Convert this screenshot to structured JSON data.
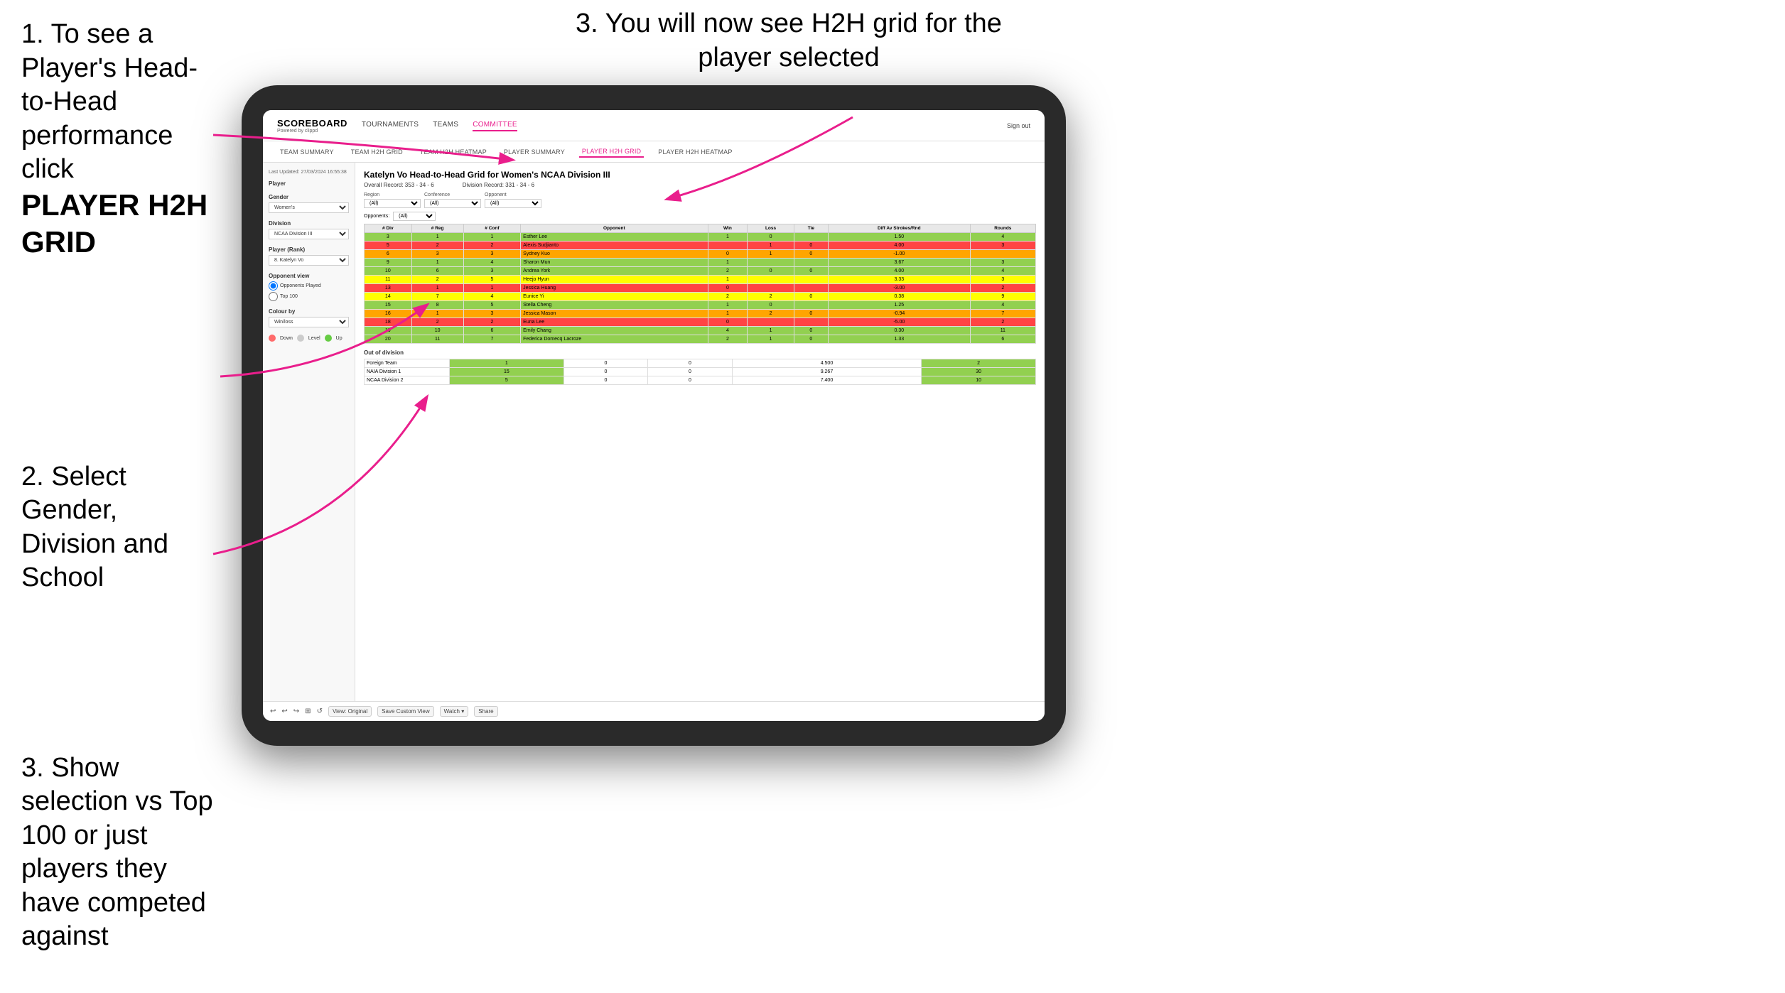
{
  "instructions": {
    "step1": {
      "text": "1. To see a Player's Head-to-Head performance click",
      "bold": "PLAYER H2H GRID"
    },
    "step2": {
      "text": "2. Select Gender, Division and School"
    },
    "step3_left": {
      "text": "3. Show selection vs Top 100 or just players they have competed against"
    },
    "step3_right": {
      "text": "3. You will now see H2H grid for the player selected"
    }
  },
  "nav": {
    "logo": "SCOREBOARD",
    "logo_sub": "Powered by clippd",
    "items": [
      "TOURNAMENTS",
      "TEAMS",
      "COMMITTEE"
    ],
    "sign_out": "Sign out",
    "sub_items": [
      "TEAM SUMMARY",
      "TEAM H2H GRID",
      "TEAM H2H HEATMAP",
      "PLAYER SUMMARY",
      "PLAYER H2H GRID",
      "PLAYER H2H HEATMAP"
    ]
  },
  "sidebar": {
    "updated": "Last Updated: 27/03/2024 16:55:38",
    "player_label": "Player",
    "gender_label": "Gender",
    "gender_value": "Women's",
    "division_label": "Division",
    "division_value": "NCAA Division III",
    "player_rank_label": "Player (Rank)",
    "player_rank_value": "8. Katelyn Vo",
    "opponent_view_label": "Opponent view",
    "radio1": "Opponents Played",
    "radio2": "Top 100",
    "colour_label": "Colour by",
    "colour_value": "Win/loss",
    "legend": [
      "Down",
      "Level",
      "Up"
    ]
  },
  "grid": {
    "title": "Katelyn Vo Head-to-Head Grid for Women's NCAA Division III",
    "overall_record": "Overall Record: 353 - 34 - 6",
    "division_record": "Division Record: 331 - 34 - 6",
    "region_label": "Region",
    "conference_label": "Conference",
    "opponent_label": "Opponent",
    "opponents_label": "Opponents:",
    "filter_all": "(All)",
    "columns": [
      "# Div",
      "# Reg",
      "# Conf",
      "Opponent",
      "Win",
      "Loss",
      "Tie",
      "Diff Av Strokes/Rnd",
      "Rounds"
    ],
    "rows": [
      {
        "div": "3",
        "reg": "1",
        "conf": "1",
        "opponent": "Esther Lee",
        "win": "1",
        "loss": "0",
        "tie": "",
        "diff": "1.50",
        "rounds": "4",
        "win_color": "green",
        "loss_color": "",
        "tie_color": ""
      },
      {
        "div": "5",
        "reg": "2",
        "conf": "2",
        "opponent": "Alexis Sudjianto",
        "win": "",
        "loss": "1",
        "tie": "0",
        "diff": "4.00",
        "rounds": "3",
        "win_color": "",
        "loss_color": "red",
        "tie_color": ""
      },
      {
        "div": "6",
        "reg": "3",
        "conf": "3",
        "opponent": "Sydney Kuo",
        "win": "0",
        "loss": "1",
        "tie": "0",
        "diff": "-1.00",
        "rounds": "",
        "win_color": "",
        "loss_color": "orange",
        "tie_color": ""
      },
      {
        "div": "9",
        "reg": "1",
        "conf": "4",
        "opponent": "Sharon Mun",
        "win": "1",
        "loss": "",
        "tie": "",
        "diff": "3.67",
        "rounds": "3",
        "win_color": "green",
        "loss_color": "",
        "tie_color": ""
      },
      {
        "div": "10",
        "reg": "6",
        "conf": "3",
        "opponent": "Andrea York",
        "win": "2",
        "loss": "0",
        "tie": "0",
        "diff": "4.00",
        "rounds": "4",
        "win_color": "green",
        "loss_color": "",
        "tie_color": ""
      },
      {
        "div": "11",
        "reg": "2",
        "conf": "5",
        "opponent": "Heejo Hyun",
        "win": "1",
        "loss": "",
        "tie": "",
        "diff": "3.33",
        "rounds": "3",
        "win_color": "yellow",
        "loss_color": "",
        "tie_color": ""
      },
      {
        "div": "13",
        "reg": "1",
        "conf": "1",
        "opponent": "Jessica Huang",
        "win": "0",
        "loss": "",
        "tie": "",
        "diff": "-3.00",
        "rounds": "2",
        "win_color": "",
        "loss_color": "red",
        "tie_color": ""
      },
      {
        "div": "14",
        "reg": "7",
        "conf": "4",
        "opponent": "Eunice Yi",
        "win": "2",
        "loss": "2",
        "tie": "0",
        "diff": "0.38",
        "rounds": "9",
        "win_color": "yellow",
        "loss_color": "",
        "tie_color": ""
      },
      {
        "div": "15",
        "reg": "8",
        "conf": "5",
        "opponent": "Stella Cheng",
        "win": "1",
        "loss": "0",
        "tie": "",
        "diff": "1.25",
        "rounds": "4",
        "win_color": "green",
        "loss_color": "",
        "tie_color": ""
      },
      {
        "div": "16",
        "reg": "1",
        "conf": "3",
        "opponent": "Jessica Mason",
        "win": "1",
        "loss": "2",
        "tie": "0",
        "diff": "-0.94",
        "rounds": "7",
        "win_color": "",
        "loss_color": "orange",
        "tie_color": ""
      },
      {
        "div": "18",
        "reg": "2",
        "conf": "2",
        "opponent": "Euna Lee",
        "win": "0",
        "loss": "",
        "tie": "",
        "diff": "-5.00",
        "rounds": "2",
        "win_color": "",
        "loss_color": "red",
        "tie_color": ""
      },
      {
        "div": "19",
        "reg": "10",
        "conf": "6",
        "opponent": "Emily Chang",
        "win": "4",
        "loss": "1",
        "tie": "0",
        "diff": "0.30",
        "rounds": "11",
        "win_color": "green",
        "loss_color": "",
        "tie_color": ""
      },
      {
        "div": "20",
        "reg": "11",
        "conf": "7",
        "opponent": "Federica Domecq Lacroze",
        "win": "2",
        "loss": "1",
        "tie": "0",
        "diff": "1.33",
        "rounds": "6",
        "win_color": "green",
        "loss_color": "",
        "tie_color": ""
      }
    ],
    "out_of_division_label": "Out of division",
    "out_of_division_rows": [
      {
        "label": "Foreign Team",
        "win": "1",
        "loss": "0",
        "tie": "0",
        "diff": "4.500",
        "rounds": "2"
      },
      {
        "label": "NAIA Division 1",
        "win": "15",
        "loss": "0",
        "tie": "0",
        "diff": "9.267",
        "rounds": "30"
      },
      {
        "label": "NCAA Division 2",
        "win": "5",
        "loss": "0",
        "tie": "0",
        "diff": "7.400",
        "rounds": "10"
      }
    ]
  },
  "toolbar": {
    "undo": "↩",
    "redo": "↪",
    "view_original": "View: Original",
    "save_custom": "Save Custom View",
    "watch": "Watch ▾",
    "share": "Share"
  }
}
